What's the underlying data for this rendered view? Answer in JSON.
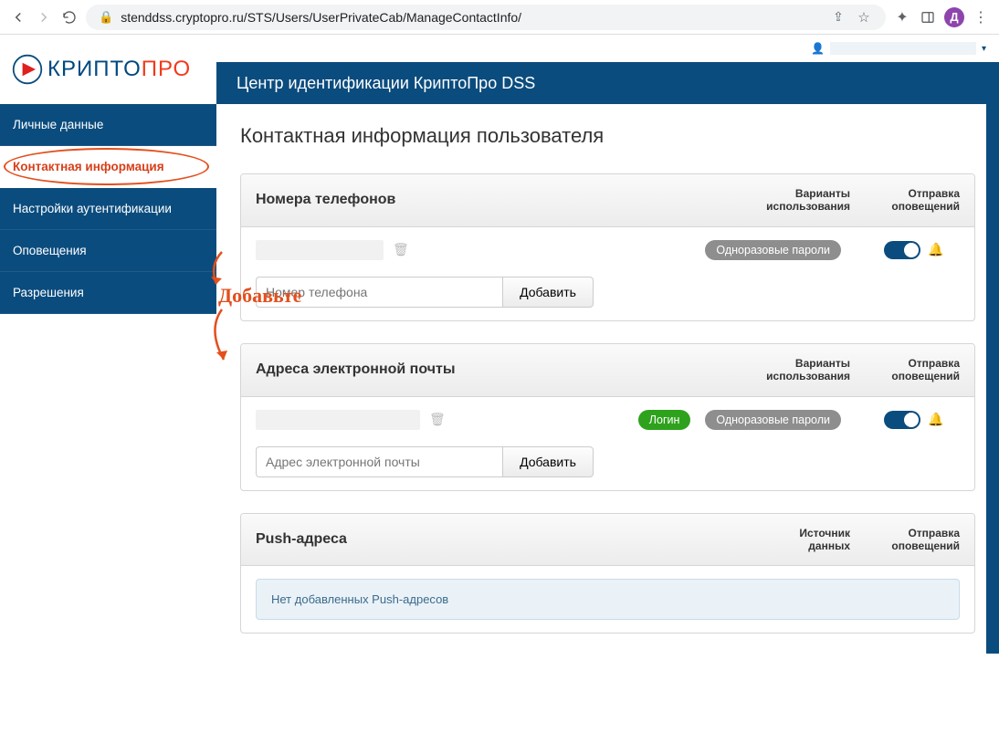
{
  "chrome": {
    "url": "stenddss.cryptopro.ru/STS/Users/UserPrivateCab/ManageContactInfo/",
    "avatar_letter": "Д"
  },
  "header": {
    "logo_part1": "КРИПТО",
    "logo_part2": "ПРО",
    "banner_title": "Центр идентификации КриптоПро DSS"
  },
  "sidebar": {
    "items": [
      {
        "label": "Личные данные",
        "active": false
      },
      {
        "label": "Контактная информация",
        "active": true
      },
      {
        "label": "Настройки аутентификации",
        "active": false
      },
      {
        "label": "Оповещения",
        "active": false
      },
      {
        "label": "Разрешения",
        "active": false
      }
    ]
  },
  "page": {
    "title": "Контактная информация пользователя",
    "col_variants_line1": "Варианты",
    "col_variants_line2": "использования",
    "col_notify_line1": "Отправка",
    "col_notify_line2": "оповещений",
    "col_source_line1": "Источник",
    "col_source_line2": "данных",
    "add_button": "Добавить",
    "annotation": "Добавьте",
    "phones": {
      "title": "Номера телефонов",
      "placeholder": "Номер телефона",
      "pill_otp": "Одноразовые пароли"
    },
    "emails": {
      "title": "Адреса электронной почты",
      "placeholder": "Адрес электронной почты",
      "pill_login": "Логин",
      "pill_otp": "Одноразовые пароли"
    },
    "push": {
      "title": "Push-адреса",
      "empty": "Нет добавленных Push-адресов"
    }
  }
}
